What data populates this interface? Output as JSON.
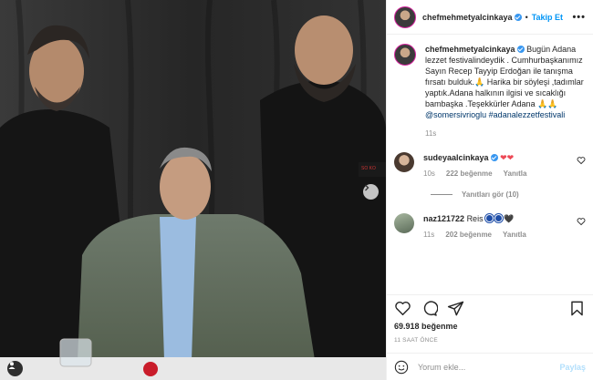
{
  "post": {
    "author": "chefmehmetyalcinkaya",
    "follow_label": "Takip Et",
    "more_label": "•••",
    "caption": {
      "text": "Bugün Adana lezzet festivalindeydik . Cumhurbaşkanımız Sayın Recep Tayyip Erdoğan ile tanışma fırsatı bulduk.🙏 Harika bir söyleşi ,tadımlar yaptık.Adana halkının ilgisi ve sıcaklığı bambaşka .Teşekkürler Adana 🙏🙏",
      "mention": "@somersivrioglu",
      "hashtag": "#adanalezzetfestivali",
      "age": "11s"
    },
    "comments": [
      {
        "user": "sudeyaalcinkaya",
        "text": "❤❤",
        "age": "10s",
        "likes": "222 beğenme",
        "reply_label": "Yanıtla",
        "replies_label": "Yanıtları gör (10)"
      },
      {
        "user": "naz121722",
        "text": "Reis",
        "emoji_tail": "🖤",
        "age": "11s",
        "likes": "202 beğenme",
        "reply_label": "Yanıtla"
      }
    ],
    "like_count": "69.918 beğenme",
    "posted": "11 SAAT ÖNCE",
    "comment_placeholder": "Yorum ekle...",
    "post_button": "Paylaş"
  },
  "colors": {
    "link_blue": "#0095f6",
    "hashtag": "#00376b",
    "muted": "#8e8e8e",
    "heart": "#ed4956"
  }
}
